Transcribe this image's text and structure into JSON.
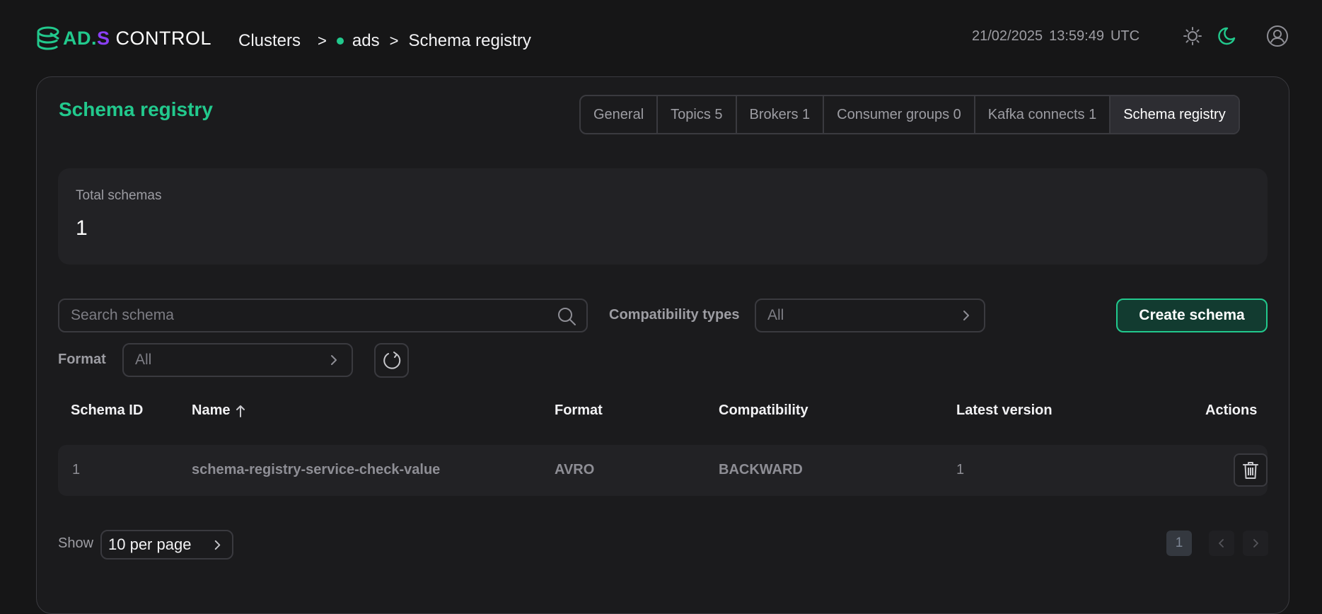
{
  "header": {
    "logo": {
      "part1": "AD.",
      "part2": "S",
      "part3": "CONTROL"
    },
    "breadcrumb": {
      "clusters": "Clusters",
      "sep": ">",
      "cluster": "ads",
      "page": "Schema registry"
    },
    "datetime": {
      "date": "21/02/2025",
      "time": "13:59:49",
      "tz": "UTC"
    },
    "icons": {
      "sun": "sun-icon",
      "moon": "moon-icon",
      "user": "user-icon"
    }
  },
  "main": {
    "title": "Schema registry",
    "tabs": [
      {
        "label": "General"
      },
      {
        "label": "Topics 5"
      },
      {
        "label": "Brokers 1"
      },
      {
        "label": "Consumer groups 0"
      },
      {
        "label": "Kafka connects 1"
      },
      {
        "label": "Schema registry"
      }
    ],
    "stats": {
      "label": "Total schemas",
      "value": "1"
    },
    "filters": {
      "search_placeholder": "Search schema",
      "compat_label": "Compatibility types",
      "compat_value": "All",
      "format_label": "Format",
      "format_value": "All",
      "create_label": "Create schema"
    },
    "table": {
      "headers": {
        "id": "Schema ID",
        "name": "Name",
        "format": "Format",
        "compat": "Compatibility",
        "latest": "Latest version",
        "actions": "Actions"
      },
      "rows": [
        {
          "id": "1",
          "name": "schema-registry-service-check-value",
          "format": "AVRO",
          "compat": "BACKWARD",
          "latest": "1"
        }
      ]
    },
    "pagination": {
      "show_label": "Show",
      "per_page": "10 per page",
      "current_page": "1"
    }
  },
  "colors": {
    "accent": "#22c98d",
    "brand_purple": "#8a3ff5",
    "background": "#161617",
    "panel": "#1b1b1d",
    "border": "#3a3a3f"
  }
}
